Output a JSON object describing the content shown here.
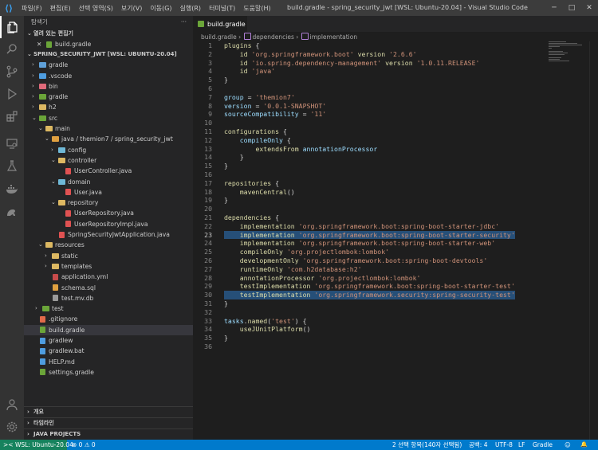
{
  "titlebar": {
    "logo": "vscode-logo",
    "menu": [
      "파일(F)",
      "편집(E)",
      "선택 영역(S)",
      "보기(V)",
      "이동(G)",
      "실행(R)",
      "터미널(T)",
      "도움말(H)"
    ],
    "title": "build.gradle - spring_security_jwt [WSL: Ubuntu-20.04] - Visual Studio Code",
    "buttons": {
      "minimize": "─",
      "maximize": "□",
      "close": "✕"
    }
  },
  "activitybar": [
    "explorer-icon",
    "search-icon",
    "source-control-icon",
    "run-debug-icon",
    "extensions-icon",
    "remote-explorer-icon",
    "testing-icon",
    "docker-icon",
    "gradle-icon",
    "account-icon",
    "settings-gear-icon"
  ],
  "sidebar": {
    "title": "탐색기",
    "open_editors": {
      "header": "열려 있는 편집기",
      "close_mark": "✕",
      "file": "build.gradle"
    },
    "project": {
      "header": "SPRING_SECURITY_JWT [WSL: UBUNTU-20.04]",
      "items": [
        {
          "label": "gradle",
          "type": "folder",
          "depth": 0,
          "expanded": false,
          "color": "#5fa0d8"
        },
        {
          "label": ".vscode",
          "type": "folder",
          "depth": 0,
          "expanded": false,
          "color": "#4e9de0"
        },
        {
          "label": "bin",
          "type": "folder",
          "depth": 0,
          "expanded": false,
          "color": "#e06a7a"
        },
        {
          "label": "gradle",
          "type": "folder",
          "depth": 0,
          "expanded": false,
          "color": "#6ba539"
        },
        {
          "label": "h2",
          "type": "folder",
          "depth": 0,
          "expanded": false,
          "color": "#dcb862"
        },
        {
          "label": "src",
          "type": "folder",
          "depth": 0,
          "expanded": true,
          "color": "#6ba539"
        },
        {
          "label": "main",
          "type": "folder",
          "depth": 1,
          "expanded": true,
          "color": "#dcb862"
        },
        {
          "label": "java / themion7 / spring_security_jwt",
          "type": "folder",
          "depth": 2,
          "expanded": true,
          "color": "#e0a040"
        },
        {
          "label": "config",
          "type": "folder",
          "depth": 3,
          "expanded": false,
          "color": "#6fb8d6"
        },
        {
          "label": "controller",
          "type": "folder",
          "depth": 3,
          "expanded": true,
          "color": "#dcb862"
        },
        {
          "label": "UserController.java",
          "type": "file",
          "depth": 4,
          "color": "#e05252"
        },
        {
          "label": "domain",
          "type": "folder",
          "depth": 3,
          "expanded": true,
          "color": "#6fb8d6"
        },
        {
          "label": "User.java",
          "type": "file",
          "depth": 4,
          "color": "#e05252"
        },
        {
          "label": "repository",
          "type": "folder",
          "depth": 3,
          "expanded": true,
          "color": "#dcb862"
        },
        {
          "label": "UserRepository.java",
          "type": "file",
          "depth": 4,
          "color": "#e05252"
        },
        {
          "label": "UserRepositoryImpl.java",
          "type": "file",
          "depth": 4,
          "color": "#e05252"
        },
        {
          "label": "SpringSecurityJwtApplication.java",
          "type": "file",
          "depth": 3,
          "color": "#e05252"
        },
        {
          "label": "resources",
          "type": "folder",
          "depth": 1,
          "expanded": true,
          "color": "#dcb862"
        },
        {
          "label": "static",
          "type": "folder",
          "depth": 2,
          "expanded": false,
          "color": "#dcb862"
        },
        {
          "label": "templates",
          "type": "folder",
          "depth": 2,
          "expanded": false,
          "color": "#dcb862"
        },
        {
          "label": "application.yml",
          "type": "file",
          "depth": 2,
          "color": "#c74b4b"
        },
        {
          "label": "schema.sql",
          "type": "file",
          "depth": 2,
          "color": "#e0a040"
        },
        {
          "label": "test.mv.db",
          "type": "file",
          "depth": 2,
          "color": "#9a9a9a"
        },
        {
          "label": "test",
          "type": "folder",
          "depth": 0,
          "expanded": false,
          "color": "#6ba539",
          "indent_extra": true
        },
        {
          "label": ".gitignore",
          "type": "file",
          "depth": 0,
          "color": "#e06a4a"
        },
        {
          "label": "build.gradle",
          "type": "file",
          "depth": 0,
          "color": "#6ba539",
          "selected": true
        },
        {
          "label": "gradlew",
          "type": "file",
          "depth": 0,
          "color": "#4e9de0"
        },
        {
          "label": "gradlew.bat",
          "type": "file",
          "depth": 0,
          "color": "#4e9de0"
        },
        {
          "label": "HELP.md",
          "type": "file",
          "depth": 0,
          "color": "#4e9de0"
        },
        {
          "label": "settings.gradle",
          "type": "file",
          "depth": 0,
          "color": "#6ba539"
        }
      ]
    },
    "bottom_sections": [
      "개요",
      "타임라인",
      "JAVA PROJECTS"
    ]
  },
  "editor": {
    "tab": "build.gradle",
    "breadcrumb": {
      "file": "build.gradle",
      "sep": "›",
      "node1": "dependencies",
      "node2": "implementation"
    },
    "active_line": 23,
    "highlighted_lines": [
      23,
      30
    ],
    "lines": [
      [
        [
          "fn",
          "plugins"
        ],
        [
          "p",
          " {"
        ]
      ],
      [
        [
          "p",
          "    "
        ],
        [
          "fn",
          "id"
        ],
        [
          "p",
          " "
        ],
        [
          "s",
          "'org.springframework.boot'"
        ],
        [
          "p",
          " "
        ],
        [
          "fn",
          "version"
        ],
        [
          "p",
          " "
        ],
        [
          "s",
          "'2.6.6'"
        ]
      ],
      [
        [
          "p",
          "    "
        ],
        [
          "fn",
          "id"
        ],
        [
          "p",
          " "
        ],
        [
          "s",
          "'io.spring.dependency-management'"
        ],
        [
          "p",
          " "
        ],
        [
          "fn",
          "version"
        ],
        [
          "p",
          " "
        ],
        [
          "s",
          "'1.0.11.RELEASE'"
        ]
      ],
      [
        [
          "p",
          "    "
        ],
        [
          "fn",
          "id"
        ],
        [
          "p",
          " "
        ],
        [
          "s",
          "'java'"
        ]
      ],
      [
        [
          "p",
          "}"
        ]
      ],
      [],
      [
        [
          "id",
          "group"
        ],
        [
          "p",
          " = "
        ],
        [
          "s",
          "'themion7'"
        ]
      ],
      [
        [
          "id",
          "version"
        ],
        [
          "p",
          " = "
        ],
        [
          "s",
          "'0.0.1-SNAPSHOT'"
        ]
      ],
      [
        [
          "id",
          "sourceCompatibility"
        ],
        [
          "p",
          " = "
        ],
        [
          "s",
          "'11'"
        ]
      ],
      [],
      [
        [
          "fn",
          "configurations"
        ],
        [
          "p",
          " {"
        ]
      ],
      [
        [
          "p",
          "    "
        ],
        [
          "id",
          "compileOnly"
        ],
        [
          "p",
          " {"
        ]
      ],
      [
        [
          "p",
          "        "
        ],
        [
          "fn",
          "extendsFrom"
        ],
        [
          "p",
          " "
        ],
        [
          "id",
          "annotationProcessor"
        ]
      ],
      [
        [
          "p",
          "    }"
        ]
      ],
      [
        [
          "p",
          "}"
        ]
      ],
      [],
      [
        [
          "fn",
          "repositories"
        ],
        [
          "p",
          " {"
        ]
      ],
      [
        [
          "p",
          "    "
        ],
        [
          "fn",
          "mavenCentral"
        ],
        [
          "p",
          "()"
        ]
      ],
      [
        [
          "p",
          "}"
        ]
      ],
      [],
      [
        [
          "fn",
          "dependencies"
        ],
        [
          "p",
          " {"
        ]
      ],
      [
        [
          "p",
          "    "
        ],
        [
          "fn",
          "implementation"
        ],
        [
          "p",
          " "
        ],
        [
          "s",
          "'org.springframework.boot:spring-boot-starter-jdbc'"
        ]
      ],
      [
        [
          "p",
          "    "
        ],
        [
          "fn",
          "implementation"
        ],
        [
          "p",
          " "
        ],
        [
          "s",
          "'org.springframework.boot:spring-boot-starter-security'"
        ]
      ],
      [
        [
          "p",
          "    "
        ],
        [
          "fn",
          "implementation"
        ],
        [
          "p",
          " "
        ],
        [
          "s",
          "'org.springframework.boot:spring-boot-starter-web'"
        ]
      ],
      [
        [
          "p",
          "    "
        ],
        [
          "fn",
          "compileOnly"
        ],
        [
          "p",
          " "
        ],
        [
          "s",
          "'org.projectlombok:lombok'"
        ]
      ],
      [
        [
          "p",
          "    "
        ],
        [
          "fn",
          "developmentOnly"
        ],
        [
          "p",
          " "
        ],
        [
          "s",
          "'org.springframework.boot:spring-boot-devtools'"
        ]
      ],
      [
        [
          "p",
          "    "
        ],
        [
          "fn",
          "runtimeOnly"
        ],
        [
          "p",
          " "
        ],
        [
          "s",
          "'com.h2database:h2'"
        ]
      ],
      [
        [
          "p",
          "    "
        ],
        [
          "fn",
          "annotationProcessor"
        ],
        [
          "p",
          " "
        ],
        [
          "s",
          "'org.projectlombok:lombok'"
        ]
      ],
      [
        [
          "p",
          "    "
        ],
        [
          "fn",
          "testImplementation"
        ],
        [
          "p",
          " "
        ],
        [
          "s",
          "'org.springframework.boot:spring-boot-starter-test'"
        ]
      ],
      [
        [
          "p",
          "    "
        ],
        [
          "fn",
          "testImplementation"
        ],
        [
          "p",
          " "
        ],
        [
          "s",
          "'org.springframework.security:spring-security-test'"
        ]
      ],
      [
        [
          "p",
          "}"
        ]
      ],
      [],
      [
        [
          "id",
          "tasks"
        ],
        [
          "p",
          "."
        ],
        [
          "fn",
          "named"
        ],
        [
          "p",
          "("
        ],
        [
          "s",
          "'test'"
        ],
        [
          "p",
          ") {"
        ]
      ],
      [
        [
          "p",
          "    "
        ],
        [
          "fn",
          "useJUnitPlatform"
        ],
        [
          "p",
          "()"
        ]
      ],
      [
        [
          "p",
          "}"
        ]
      ],
      []
    ]
  },
  "statusbar": {
    "remote": "WSL: Ubuntu-20.04",
    "problems": "⊗ 0 ⚠ 0",
    "selection": "2 선택 항목(140자 선택됨)",
    "indent": "공백: 4",
    "encoding": "UTF-8",
    "eol": "LF",
    "language": "Gradle",
    "feedback": "☺",
    "bell": "🔔"
  }
}
